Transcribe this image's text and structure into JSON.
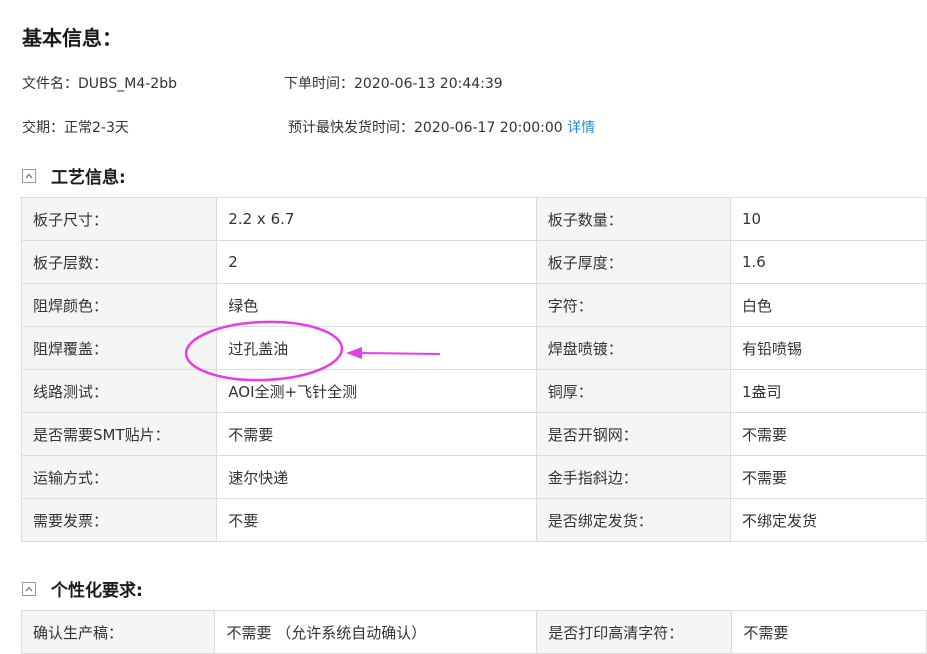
{
  "basic": {
    "title": "基本信息：",
    "filename_label": "文件名：",
    "filename_value": "DUBS_M4-2bb",
    "order_time_label": "下单时间：",
    "order_time_value": "2020-06-13 20:44:39",
    "delivery_label": "交期：",
    "delivery_value": "正常2-3天",
    "ship_time_label": "预计最快发货时间：",
    "ship_time_value": "2020-06-17 20:00:00",
    "detail_link": "详情"
  },
  "process": {
    "title": "工艺信息:",
    "rows": [
      [
        "板子尺寸：",
        "2.2 x 6.7",
        "板子数量：",
        "10"
      ],
      [
        "板子层数：",
        "2",
        "板子厚度：",
        "1.6"
      ],
      [
        "阻焊颜色：",
        "绿色",
        "字符：",
        "白色"
      ],
      [
        "阻焊覆盖：",
        "过孔盖油",
        "焊盘喷镀：",
        "有铅喷锡"
      ],
      [
        "线路测试：",
        "AOI全测+飞针全测",
        "铜厚：",
        "1盎司"
      ],
      [
        "是否需要SMT贴片：",
        "不需要",
        "是否开钢网：",
        "不需要"
      ],
      [
        "运输方式：",
        "速尔快递",
        "金手指斜边：",
        "不需要"
      ],
      [
        "需要发票：",
        "不要",
        "是否绑定发货：",
        "不绑定发货"
      ]
    ]
  },
  "custom": {
    "title": "个性化要求:",
    "rows": [
      [
        "确认生产稿：",
        "不需要 （允许系统自动确认）",
        "是否打印高清字符：",
        "不需要"
      ]
    ]
  },
  "colors": {
    "highlight_red": "#e8262c",
    "link_blue": "#2a8bd7",
    "annotation_magenta": "#e83ce8"
  },
  "icons": {
    "collapse": "collapse-icon"
  }
}
